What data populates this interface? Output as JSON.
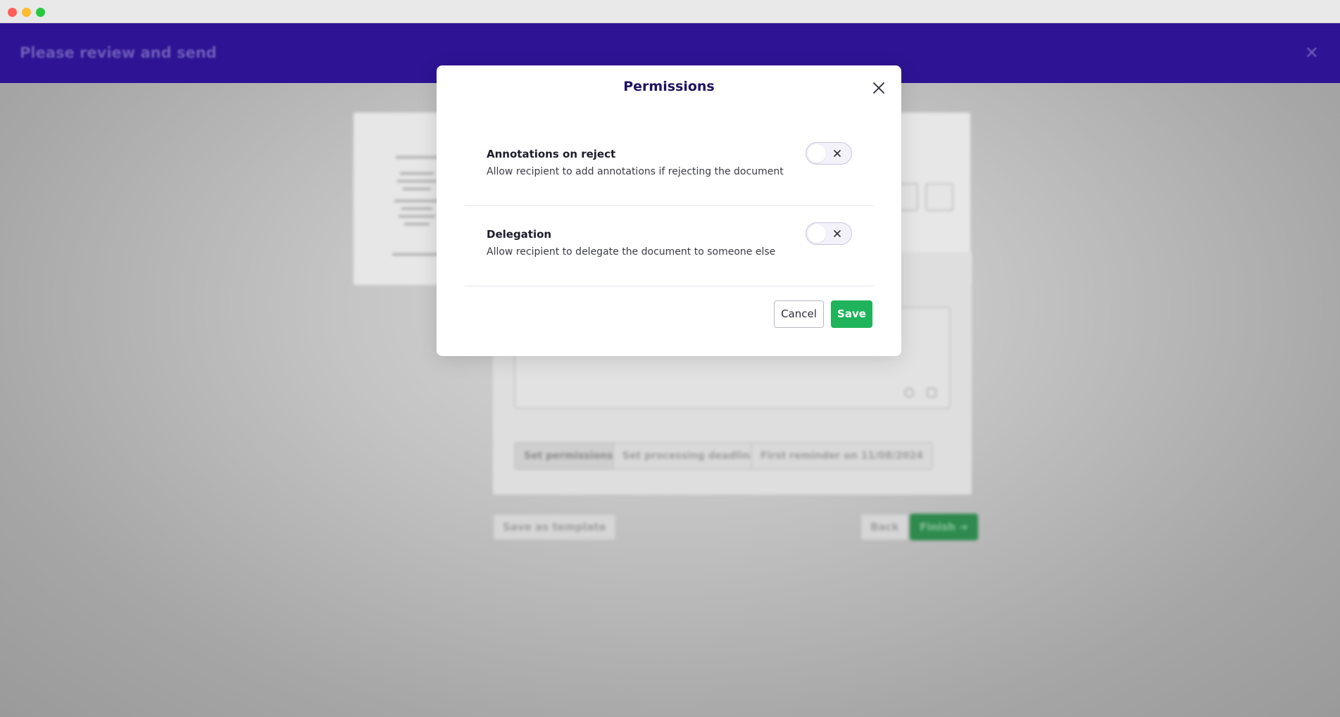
{
  "app": {
    "title": "Please review and send",
    "close_icon": "close-icon"
  },
  "background": {
    "chips": {
      "set_permissions": "Set permissions",
      "set_deadline": "Set processing deadline",
      "first_reminder": "First reminder on 11/08/2024"
    },
    "buttons": {
      "save_as_template": "Save as template",
      "back": "Back",
      "finish": "Finish"
    }
  },
  "modal": {
    "title": "Permissions",
    "permissions": [
      {
        "label": "Annotations on reject",
        "description": "Allow recipient to add annotations if rejecting the document",
        "enabled": false
      },
      {
        "label": "Delegation",
        "description": "Allow recipient to delegate the document to someone else",
        "enabled": false
      }
    ],
    "cancel_label": "Cancel",
    "save_label": "Save"
  },
  "colors": {
    "header_purple": "#2e1394",
    "title_navy": "#1f1262",
    "save_green": "#1fb35b",
    "toggle_border": "#c9c6e5"
  }
}
